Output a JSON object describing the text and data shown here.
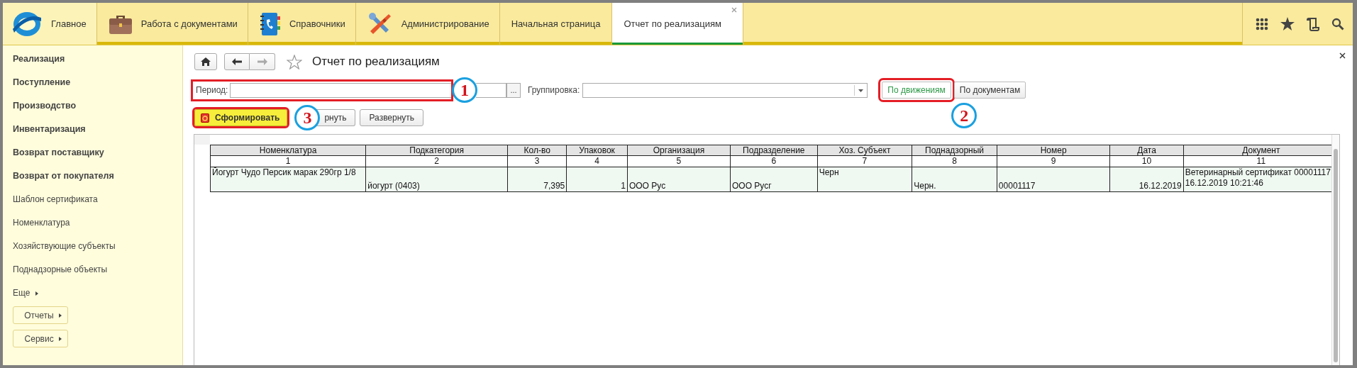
{
  "sections": [
    {
      "label": "Главное",
      "kind": "logo",
      "selected": true
    },
    {
      "label": "Работа с документами",
      "kind": "briefcase",
      "selected": false
    },
    {
      "label": "Справочники",
      "kind": "book",
      "selected": false
    },
    {
      "label": "Администрирование",
      "kind": "tools",
      "selected": false
    }
  ],
  "open_tabs": [
    {
      "label": "Начальная страница",
      "selected": false
    },
    {
      "label": "Отчет по реализациям",
      "selected": true
    }
  ],
  "sidebar": {
    "items": [
      {
        "label": "Реализация",
        "kind": "group"
      },
      {
        "label": "Поступление",
        "kind": "group"
      },
      {
        "label": "Производство",
        "kind": "group"
      },
      {
        "label": "Инвентаризация",
        "kind": "group"
      },
      {
        "label": "Возврат поставщику",
        "kind": "group"
      },
      {
        "label": "Возврат от покупателя",
        "kind": "group"
      },
      {
        "label": "Шаблон сертификата",
        "kind": "link"
      },
      {
        "label": "Номенклатура",
        "kind": "link"
      },
      {
        "label": "Хозяйствующие субъекты",
        "kind": "link"
      },
      {
        "label": "Поднадзорные объекты",
        "kind": "link"
      }
    ],
    "more": "Еще",
    "buttons": [
      "Отчеты",
      "Сервис"
    ]
  },
  "form": {
    "title": "Отчет по реализациям",
    "period": {
      "label": "Период:",
      "select": "..."
    },
    "grouping": {
      "label": "Группировка:"
    },
    "modes": [
      {
        "label": "По движениям",
        "selected": true
      },
      {
        "label": "По документам",
        "selected": false
      }
    ],
    "actions": [
      {
        "label": "Сформировать",
        "kind": "primary"
      },
      {
        "label": "рнуть",
        "kind": "plain"
      },
      {
        "label": "Развернуть",
        "kind": "plain"
      }
    ]
  },
  "annotations": [
    "1",
    "2",
    "3"
  ],
  "table": {
    "columns": [
      {
        "name": "Номенклатура",
        "number": "1"
      },
      {
        "name": "Подкатегория",
        "number": "2"
      },
      {
        "name": "Кол-во",
        "number": "3"
      },
      {
        "name": "Упаковок",
        "number": "4"
      },
      {
        "name": "Организация",
        "number": "5"
      },
      {
        "name": "Подразделение",
        "number": "6"
      },
      {
        "name": "Хоз. Субъект",
        "number": "7"
      },
      {
        "name": "Поднадзорный",
        "number": "8"
      },
      {
        "name": "Номер",
        "number": "9"
      },
      {
        "name": "Дата",
        "number": "10"
      },
      {
        "name": "Документ",
        "number": "11"
      }
    ],
    "rows": [
      [
        "Йогурт Чудо Персик марак 290гр 1/8",
        "йогурт (0403)",
        "7,395",
        "1",
        "ООО  Рус",
        "ООО Русг",
        "Черн",
        "Черн.",
        "00001117",
        "16.12.2019",
        "Ветеринарный сертификат 00001117 16.12.2019 10:21:46"
      ]
    ]
  }
}
